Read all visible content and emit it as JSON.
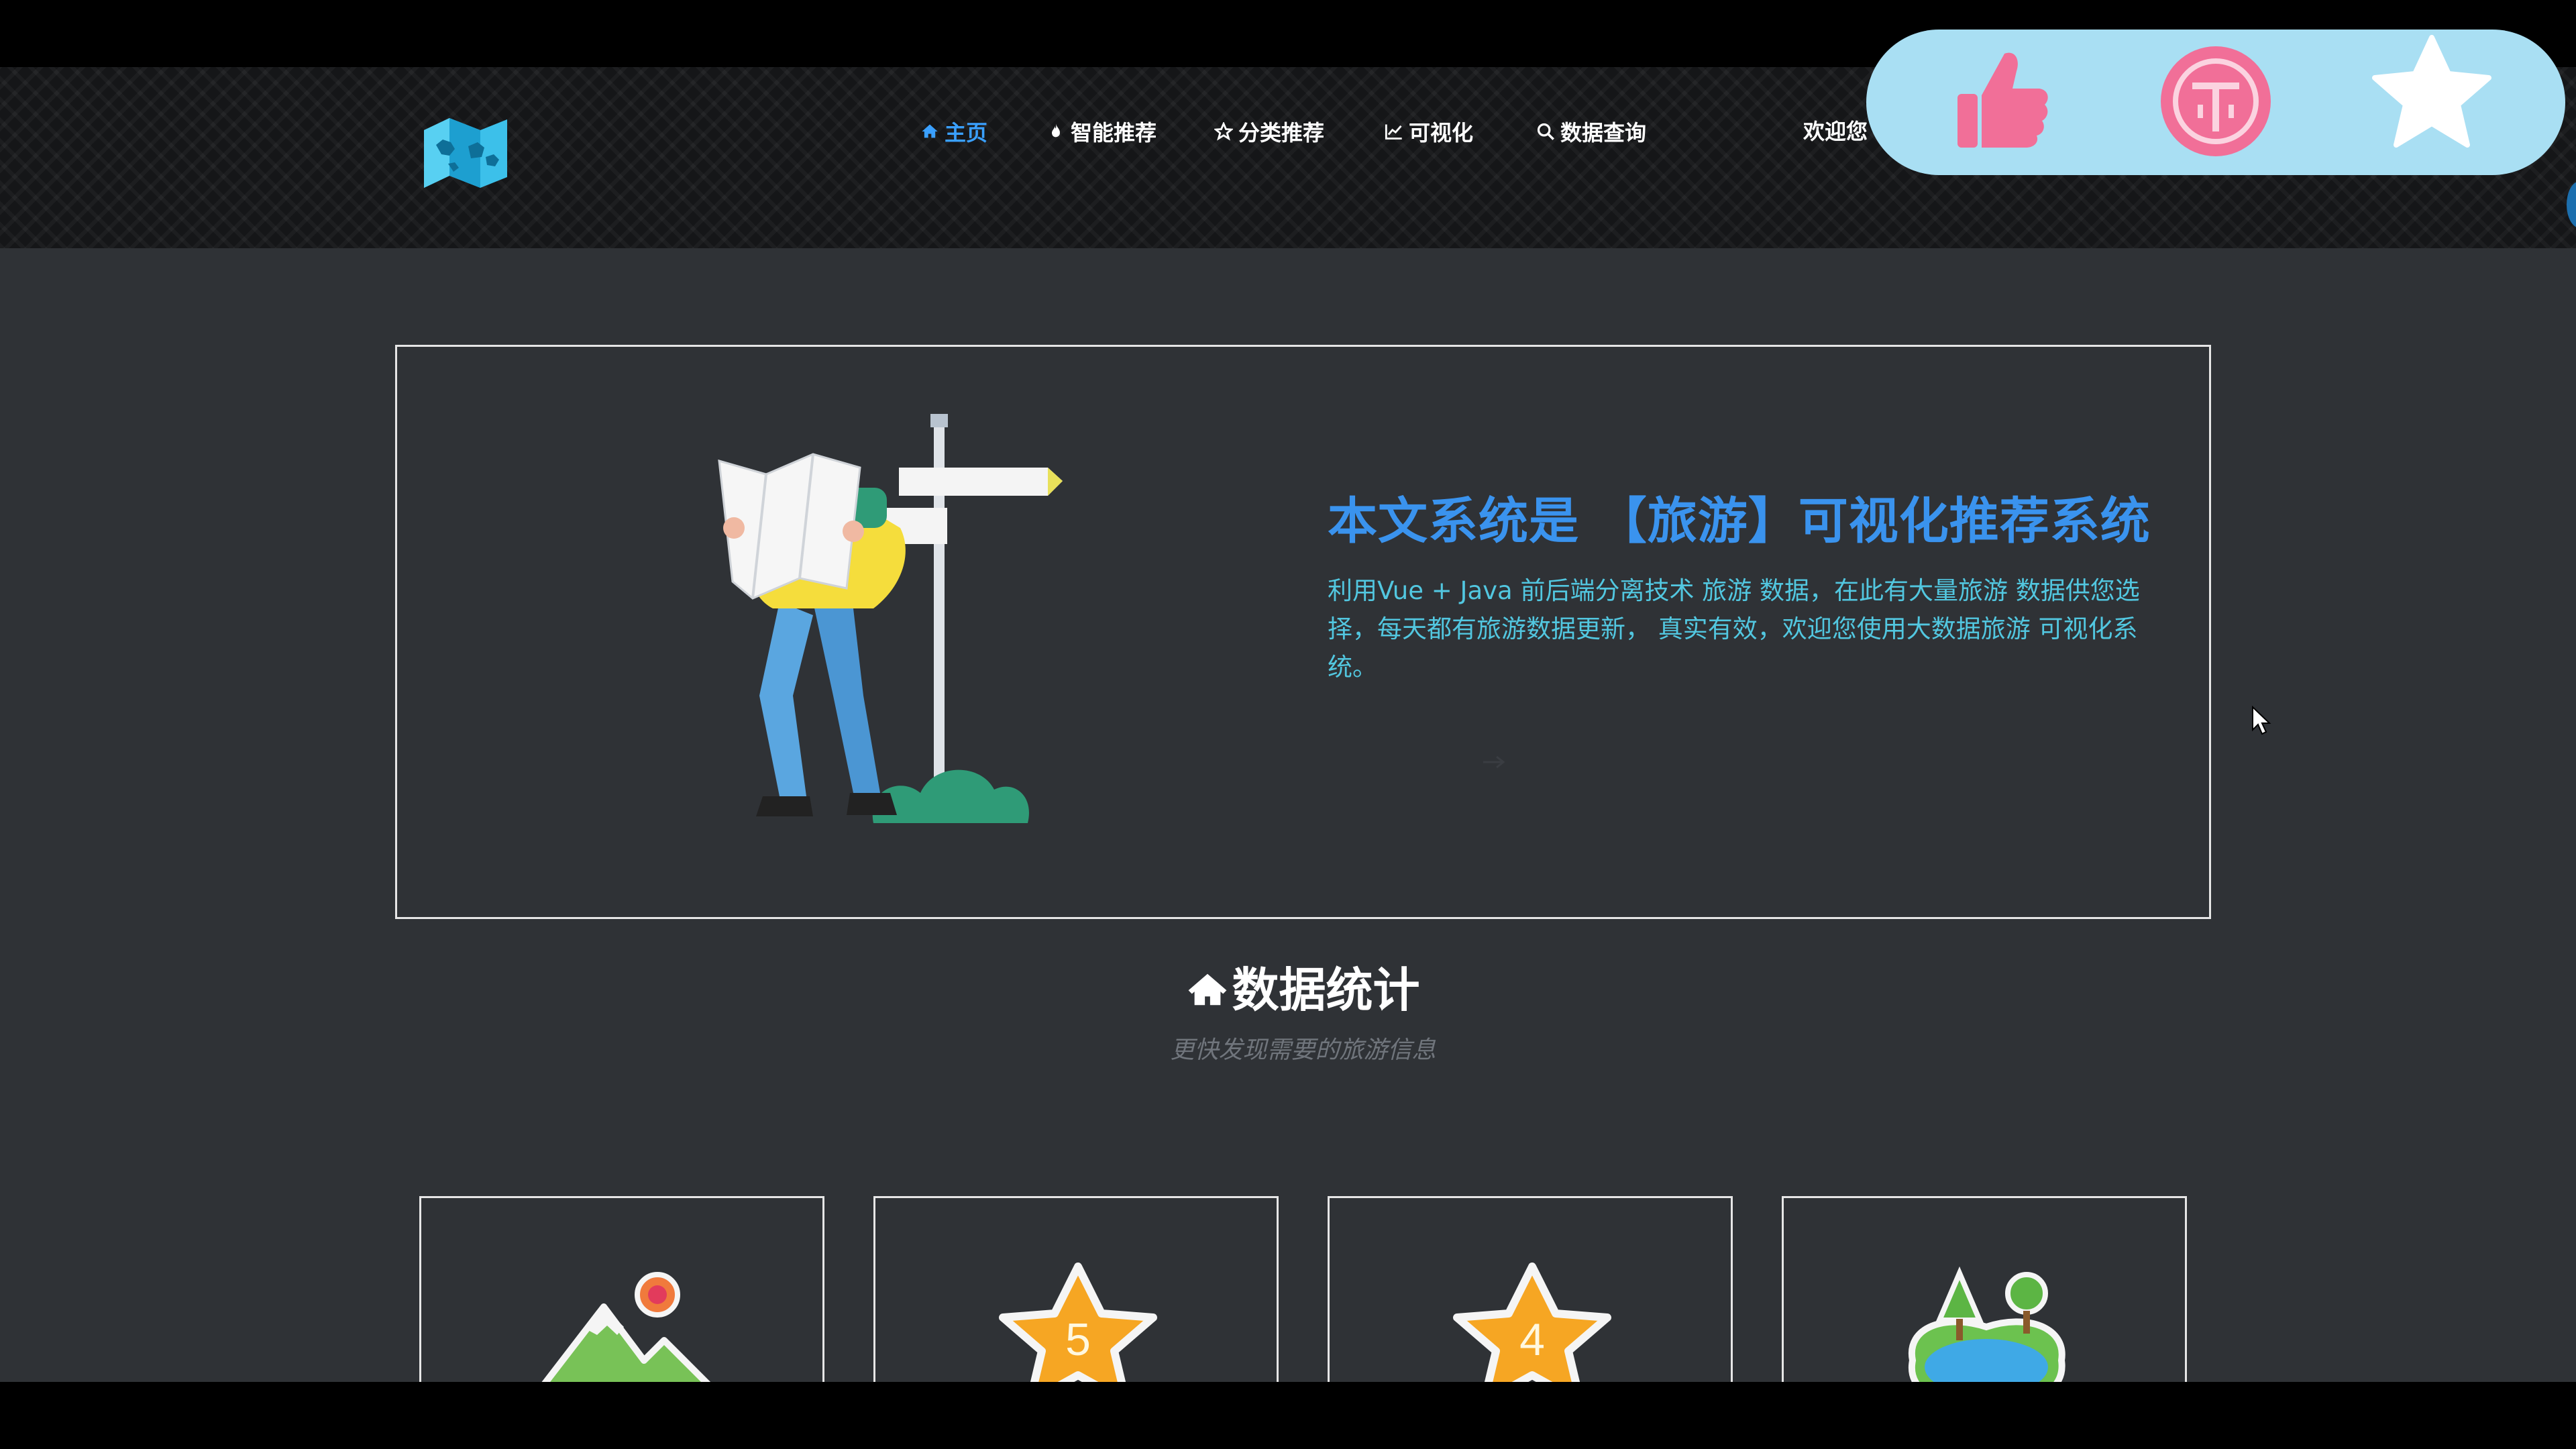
{
  "nav": {
    "items": [
      {
        "label": "主页",
        "icon": "home-icon",
        "active": true
      },
      {
        "label": "智能推荐",
        "icon": "fire-icon",
        "active": false
      },
      {
        "label": "分类推荐",
        "icon": "star-outline-icon",
        "active": false
      },
      {
        "label": "可视化",
        "icon": "line-chart-icon",
        "active": false
      },
      {
        "label": "数据查询",
        "icon": "search-icon",
        "active": false
      }
    ],
    "welcome": "欢迎您"
  },
  "hero": {
    "title": "本文系统是 【旅游】可视化推荐系统",
    "description": "利用Vue + Java 前后端分离技术 旅游 数据，在此有大量旅游 数据供您选择，每天都有旅游数据更新， 真实有效，欢迎您使用大数据旅游 可视化系统。"
  },
  "stats": {
    "title": "数据统计",
    "subtitle": "更快发现需要的旅游信息",
    "cards": [
      {
        "icon": "mountain-icon"
      },
      {
        "icon": "five-star-icon",
        "number": "5"
      },
      {
        "icon": "four-star-icon",
        "number": "4"
      },
      {
        "icon": "lake-icon"
      }
    ]
  },
  "actions": {
    "like_icon": "thumbs-up-icon",
    "coin_icon": "coin-icon",
    "favorite_icon": "star-icon"
  },
  "colors": {
    "accent": "#3a93ee",
    "description": "#52c7e0",
    "panel": "#a9dff3",
    "coin": "#f16f98"
  }
}
